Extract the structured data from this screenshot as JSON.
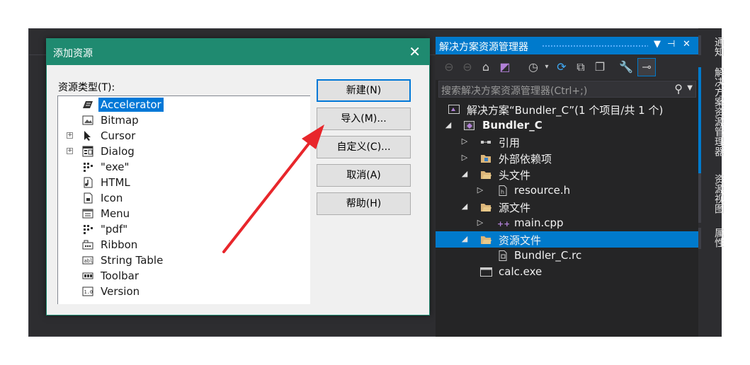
{
  "dialog": {
    "title": "添加资源",
    "close_glyph": "✕",
    "resource_type_label": "资源类型(T):",
    "tree_items": [
      {
        "label": "Accelerator",
        "icon": "accelerator-icon",
        "expander": "",
        "selected": true
      },
      {
        "label": "Bitmap",
        "icon": "bitmap-icon",
        "expander": "",
        "selected": false
      },
      {
        "label": "Cursor",
        "icon": "cursor-icon",
        "expander": "+",
        "selected": false
      },
      {
        "label": "Dialog",
        "icon": "dialog-icon",
        "expander": "+",
        "selected": false
      },
      {
        "label": "\"exe\"",
        "icon": "custom-resource-icon",
        "expander": "",
        "selected": false
      },
      {
        "label": "HTML",
        "icon": "html-icon",
        "expander": "",
        "selected": false
      },
      {
        "label": "Icon",
        "icon": "icon-resource-icon",
        "expander": "",
        "selected": false
      },
      {
        "label": "Menu",
        "icon": "menu-icon",
        "expander": "",
        "selected": false
      },
      {
        "label": "\"pdf\"",
        "icon": "custom-resource-icon",
        "expander": "",
        "selected": false
      },
      {
        "label": "Ribbon",
        "icon": "ribbon-icon",
        "expander": "",
        "selected": false
      },
      {
        "label": "String Table",
        "icon": "string-table-icon",
        "expander": "",
        "selected": false
      },
      {
        "label": "Toolbar",
        "icon": "toolbar-icon",
        "expander": "",
        "selected": false
      },
      {
        "label": "Version",
        "icon": "version-icon",
        "expander": "",
        "selected": false
      }
    ],
    "buttons": {
      "new": "新建(N)",
      "import": "导入(M)...",
      "custom": "自定义(C)...",
      "cancel": "取消(A)",
      "help": "帮助(H)"
    }
  },
  "solution_explorer": {
    "title": "解决方案资源管理器",
    "title_controls": {
      "dropdown": "▼",
      "pin": "⊣",
      "close": "✕"
    },
    "search_placeholder": "搜索解决方案资源管理器(Ctrl+;)",
    "search_icon": "search-icon",
    "tree": [
      {
        "text": "解决方案“Bundler_C”(1 个项目/共 1 个)",
        "arrow": "",
        "icon": "solution-icon",
        "bold": false,
        "selected": false
      },
      {
        "text": "Bundler_C",
        "arrow": "◢",
        "icon": "project-icon",
        "bold": true,
        "selected": false
      },
      {
        "text": "引用",
        "arrow": "▷",
        "icon": "references-icon",
        "bold": false,
        "selected": false
      },
      {
        "text": "外部依赖项",
        "arrow": "▷",
        "icon": "external-deps-icon",
        "bold": false,
        "selected": false
      },
      {
        "text": "头文件",
        "arrow": "◢",
        "icon": "folder-icon",
        "bold": false,
        "selected": false
      },
      {
        "text": "resource.h",
        "arrow": "▷",
        "icon": "header-file-icon",
        "bold": false,
        "selected": false
      },
      {
        "text": "源文件",
        "arrow": "◢",
        "icon": "folder-icon",
        "bold": false,
        "selected": false
      },
      {
        "text": "main.cpp",
        "arrow": "▷",
        "icon": "cpp-file-icon",
        "bold": false,
        "selected": false
      },
      {
        "text": "资源文件",
        "arrow": "◢",
        "icon": "folder-icon",
        "bold": false,
        "selected": true
      },
      {
        "text": "Bundler_C.rc",
        "arrow": "",
        "icon": "rc-file-icon",
        "bold": false,
        "selected": false
      },
      {
        "text": "calc.exe",
        "arrow": "",
        "icon": "exe-file-icon",
        "bold": false,
        "selected": false
      }
    ]
  },
  "side_tabs": [
    "通知",
    "解决方案资源管理器",
    "资源视图",
    "属性"
  ],
  "colors": {
    "dialog_title_bar": "#1f8a70",
    "selection": "#0078d7",
    "vs_accent": "#007acc",
    "ide_background": "#2d2d30",
    "annotation_arrow": "#e8262b"
  }
}
